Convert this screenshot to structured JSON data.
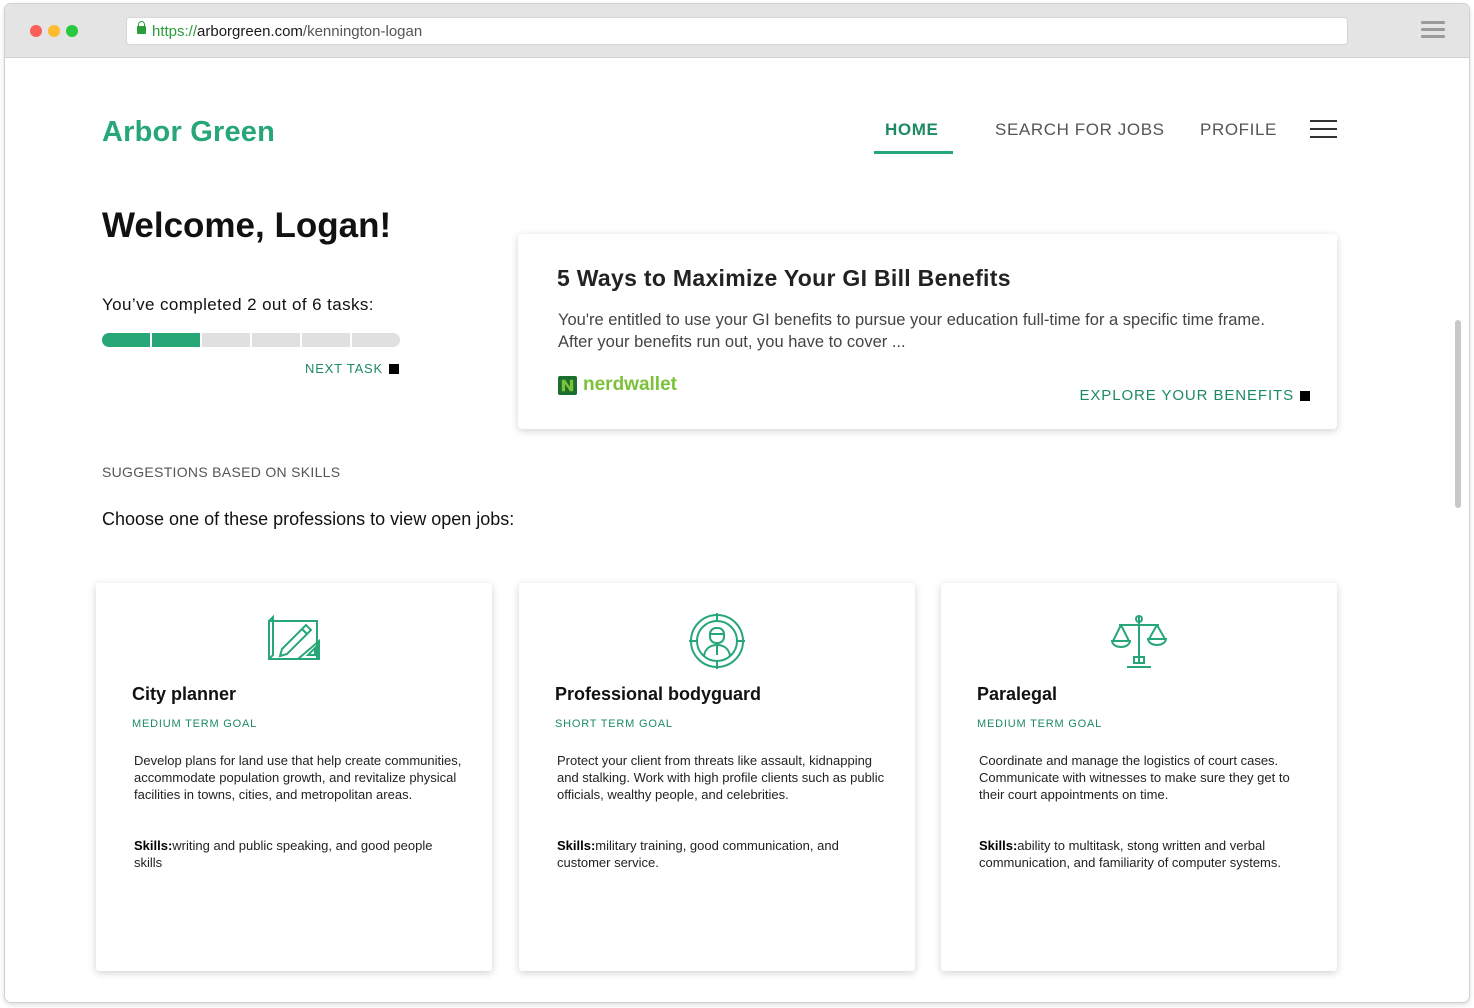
{
  "browser": {
    "url_scheme": "https://",
    "url_domain": "arborgreen.com",
    "url_path": "/kennington-logan"
  },
  "site": {
    "logo": "Arbor Green",
    "nav": {
      "home": "HOME",
      "search": "SEARCH FOR JOBS",
      "profile": "PROFILE"
    }
  },
  "welcome": "Welcome, Logan!",
  "progress": {
    "label": "You’ve completed 2 out of 6 tasks:",
    "completed": 2,
    "total": 6,
    "next_task": "NEXT TASK"
  },
  "article": {
    "title": "5 Ways to Maximize Your GI Bill Benefits",
    "body": "You're entitled to use your GI benefits to pursue your education full-time for a specific time frame. After your benefits run out, you have to cover ...",
    "source": "nerdwallet",
    "cta": "EXPLORE YOUR BENEFITS"
  },
  "suggestions_heading": "SUGGESTIONS BASED ON SKILLS",
  "choose_prompt": "Choose one of these professions to view open jobs:",
  "cards": [
    {
      "icon": "blueprint-icon",
      "title": "City planner",
      "goal": "MEDIUM TERM GOAL",
      "description": "Develop plans for land use that help create communities, accommodate population growth, and revitalize physical facilities in towns, cities, and metropolitan areas.",
      "skills_label": "Skills:",
      "skills": "writing and public speaking, and good people skills"
    },
    {
      "icon": "bodyguard-target-icon",
      "title": "Professional bodyguard",
      "goal": "SHORT TERM GOAL",
      "description": "Protect your client from threats like assault, kidnapping and stalking. Work with high profile clients such as public officials, wealthy people, and celebrities.",
      "skills_label": "Skills:",
      "skills": "military training, good communication, and customer service."
    },
    {
      "icon": "scales-of-justice-icon",
      "title": "Paralegal",
      "goal": "MEDIUM TERM GOAL",
      "description": "Coordinate and manage the logistics of court cases. Communicate with witnesses to make sure they get to their court appointments on time.",
      "skills_label": "Skills:",
      "skills": "ability to multitask, stong written and verbal communication, and familiarity of computer systems."
    }
  ],
  "colors": {
    "brand_green": "#27a777",
    "dark_green": "#1e8a62",
    "nerdwallet_green": "#7cc13a"
  }
}
